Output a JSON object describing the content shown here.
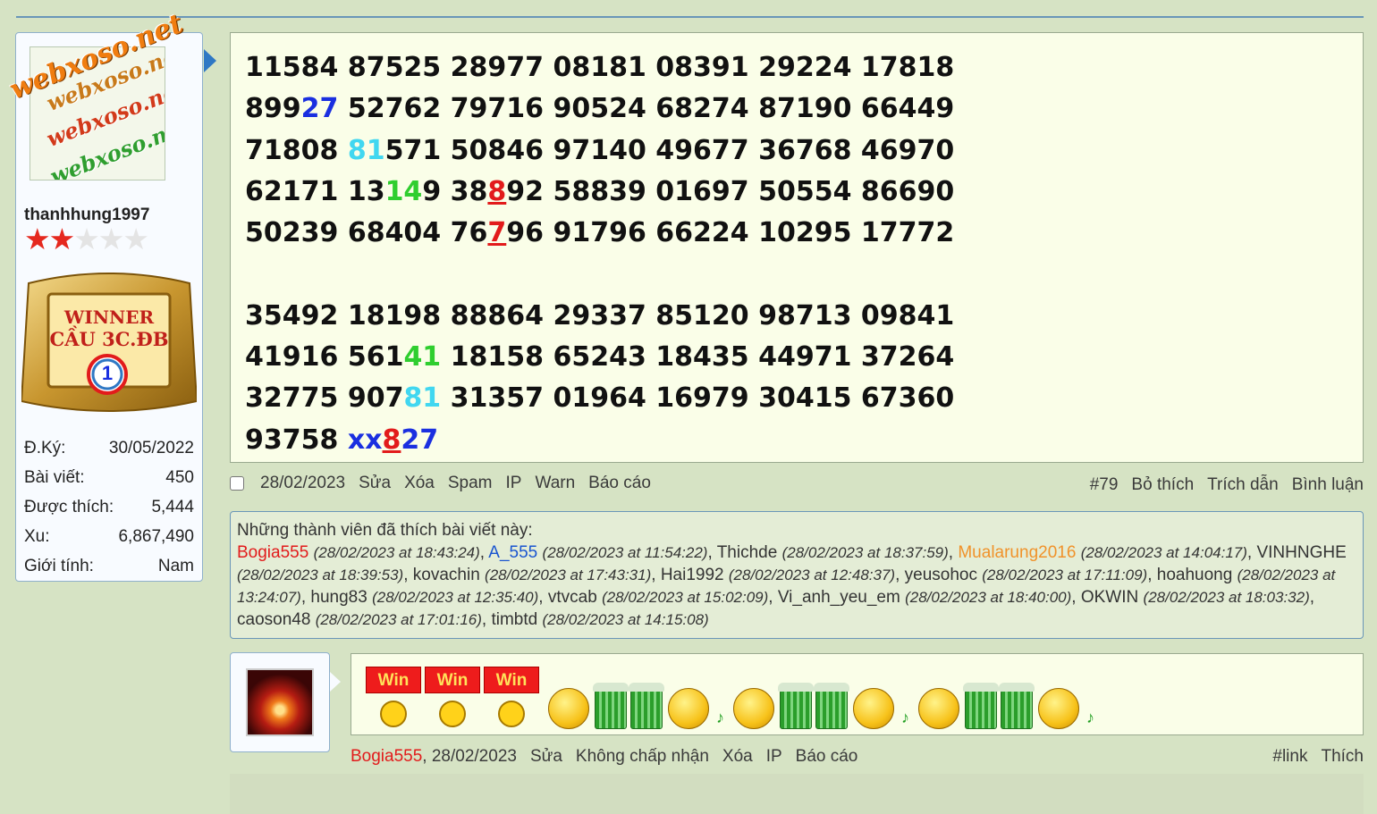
{
  "user": {
    "watermark_text": "webxoso.net",
    "username": "thanhhung1997",
    "stars_filled": 2,
    "stars_total": 5,
    "award": {
      "line1": "WINNER",
      "line2": "CẦU 3C.ĐB",
      "rank": "1"
    },
    "stats": [
      {
        "label": "Đ.Ký:",
        "value": "30/05/2022"
      },
      {
        "label": "Bài viết:",
        "value": "450"
      },
      {
        "label": "Được thích:",
        "value": "5,444"
      },
      {
        "label": "Xu:",
        "value": "6,867,490"
      },
      {
        "label": "Giới tính:",
        "value": "Nam"
      }
    ]
  },
  "post": {
    "lines": [
      [
        {
          "t": "11584 87525 28977 08181 08391 29224 17818"
        }
      ],
      [
        {
          "t": "899"
        },
        {
          "t": "27",
          "c": "blue"
        },
        {
          "t": " 52762 79716 90524 68274 87190 66449"
        }
      ],
      [
        {
          "t": "71808 "
        },
        {
          "t": "81",
          "c": "cyan"
        },
        {
          "t": "571 50846 97140 49677 36768 46970"
        }
      ],
      [
        {
          "t": "62171 13"
        },
        {
          "t": "14",
          "c": "green"
        },
        {
          "t": "9 38"
        },
        {
          "t": "8",
          "c": "red"
        },
        {
          "t": "92 58839 01697 50554 86690"
        }
      ],
      [
        {
          "t": "50239 68404 76"
        },
        {
          "t": "7",
          "c": "red"
        },
        {
          "t": "96 91796 66224 10295 17772"
        }
      ],
      [
        {
          "t": ""
        }
      ],
      [
        {
          "t": "35492 18198 88864 29337 85120 98713 09841"
        }
      ],
      [
        {
          "t": "41916 561"
        },
        {
          "t": "41",
          "c": "green"
        },
        {
          "t": " 18158 65243 18435 44971 37264"
        }
      ],
      [
        {
          "t": "32775 907"
        },
        {
          "t": "81",
          "c": "cyan"
        },
        {
          "t": " 31357 01964 16979 30415 67360"
        }
      ],
      [
        {
          "t": "93758 "
        },
        {
          "t": "xx",
          "c": "blue"
        },
        {
          "t": "8",
          "c": "red"
        },
        {
          "t": "27",
          "c": "blue"
        }
      ]
    ],
    "actions_left": [
      "28/02/2023",
      "Sửa",
      "Xóa",
      "Spam",
      "IP",
      "Warn",
      "Báo cáo"
    ],
    "actions_right": [
      "#79",
      "Bỏ thích",
      "Trích dẫn",
      "Bình luận"
    ]
  },
  "likes": {
    "title": "Những thành viên đã thích bài viết này:",
    "entries": [
      {
        "name": "Bogia555",
        "time": "(28/02/2023 at 18:43:24)",
        "color": "red"
      },
      {
        "name": "A_555",
        "time": "(28/02/2023 at 11:54:22)",
        "color": "blue"
      },
      {
        "name": "Thichde",
        "time": "(28/02/2023 at 18:37:59)"
      },
      {
        "name": "Mualarung2016",
        "time": "(28/02/2023 at 14:04:17)",
        "color": "orange"
      },
      {
        "name": "VINHNGHE",
        "time": "(28/02/2023 at 18:39:53)"
      },
      {
        "name": "kovachin",
        "time": "(28/02/2023 at 17:43:31)"
      },
      {
        "name": "Hai1992",
        "time": "(28/02/2023 at 12:48:37)"
      },
      {
        "name": "yeusohoc",
        "time": "(28/02/2023 at 17:11:09)"
      },
      {
        "name": "hoahuong",
        "time": "(28/02/2023 at 13:24:07)"
      },
      {
        "name": "hung83",
        "time": "(28/02/2023 at 12:35:40)"
      },
      {
        "name": "vtvcab",
        "time": "(28/02/2023 at 15:02:09)"
      },
      {
        "name": "Vi_anh_yeu_em",
        "time": "(28/02/2023 at 18:40:00)"
      },
      {
        "name": "OKWIN",
        "time": "(28/02/2023 at 18:03:32)"
      },
      {
        "name": "caoson48",
        "time": "(28/02/2023 at 17:01:16)"
      },
      {
        "name": "timbtd",
        "time": "(28/02/2023 at 14:15:08)"
      }
    ]
  },
  "reply": {
    "win_label": "Win",
    "win_count": 3,
    "author": "Bogia555",
    "date": ", 28/02/2023",
    "actions_left": [
      "Sửa",
      "Không chấp nhận",
      "Xóa",
      "IP",
      "Báo cáo"
    ],
    "actions_right": [
      "#link",
      "Thích"
    ]
  },
  "colors": {
    "page_bg": "#d6e3c4",
    "post_bg": "#fafee8",
    "accent_blue": "#2f78c4",
    "name_red": "#e21b1b"
  }
}
